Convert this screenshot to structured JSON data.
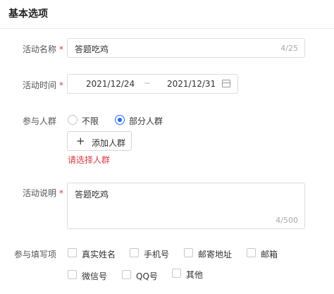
{
  "section": {
    "title": "基本选项"
  },
  "activity_name": {
    "label": "活动名称",
    "required_mark": "*",
    "value": "答题吃鸡",
    "counter": "4/25"
  },
  "activity_time": {
    "label": "活动时间",
    "required_mark": "*",
    "start": "2021/12/24",
    "separator": "~",
    "end": "2021/12/31"
  },
  "audience": {
    "label": "参与人群",
    "options": [
      {
        "label": "不限",
        "selected": false
      },
      {
        "label": "部分人群",
        "selected": true
      }
    ],
    "add_button": {
      "icon": "plus-icon",
      "label": "添加人群"
    },
    "error": "请选择人群"
  },
  "description": {
    "label": "活动说明",
    "required_mark": "*",
    "value": "答题吃鸡",
    "counter": "4/500"
  },
  "fill_fields": {
    "label": "参与填写项",
    "options": [
      "真实姓名",
      "手机号",
      "邮寄地址",
      "邮箱",
      "微信号",
      "QQ号",
      "其他"
    ]
  }
}
